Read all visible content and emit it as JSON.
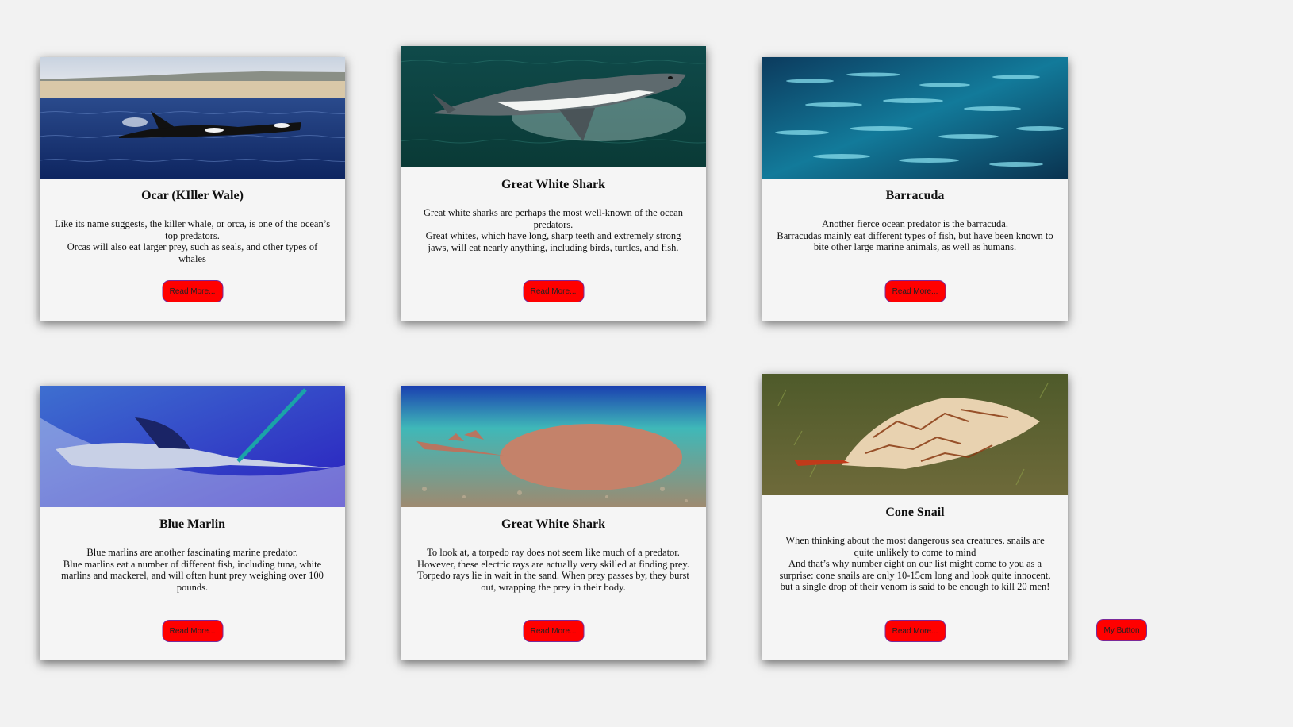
{
  "cards": [
    {
      "title": "Ocar (KIller Wale)",
      "image": "orca-photo",
      "lines": [
        "Like its name suggests, the killer whale, or orca, is one of the ocean’s top predators.",
        "Orcas will also eat larger prey, such as seals, and other types of whales"
      ],
      "button": "Read More..."
    },
    {
      "title": "Great White Shark",
      "image": "great-white-shark-photo",
      "lines": [
        "Great white sharks are perhaps the most well-known of the ocean predators.",
        "Great whites, which have long, sharp teeth and extremely strong jaws, will eat nearly anything, including birds, turtles, and fish."
      ],
      "button": "Read More..."
    },
    {
      "title": "Barracuda",
      "image": "barracuda-school-photo",
      "lines": [
        "Another fierce ocean predator is the barracuda.",
        "Barracudas mainly eat different types of fish, but have been known to bite other large marine animals, as well as humans."
      ],
      "button": "Read More..."
    },
    {
      "title": "Blue Marlin",
      "image": "blue-marlin-photo",
      "lines": [
        "Blue marlins are another fascinating marine predator.",
        "Blue marlins eat a number of different fish, including tuna, white marlins and mackerel, and will often hunt prey weighing over 100 pounds."
      ],
      "button": "Read More..."
    },
    {
      "title": "Great White Shark",
      "image": "torpedo-ray-photo",
      "lines": [
        "To look at, a torpedo ray does not seem like much of a predator.",
        "However, these electric rays are actually very skilled at finding prey. Torpedo rays lie in wait in the sand. When prey passes by, they burst out, wrapping the prey in their body."
      ],
      "button": "Read More..."
    },
    {
      "title": "Cone Snail",
      "image": "cone-snail-photo",
      "lines": [
        "When thinking about the most dangerous sea creatures, snails are quite unlikely to come to mind",
        "And that’s why number eight on our list might come to you as a surprise: cone snails are only 10-15cm long and look quite innocent, but a single drop of their venom is said to be enough to kill 20 men!"
      ],
      "button": "Read More..."
    }
  ],
  "my_button": "My Button"
}
